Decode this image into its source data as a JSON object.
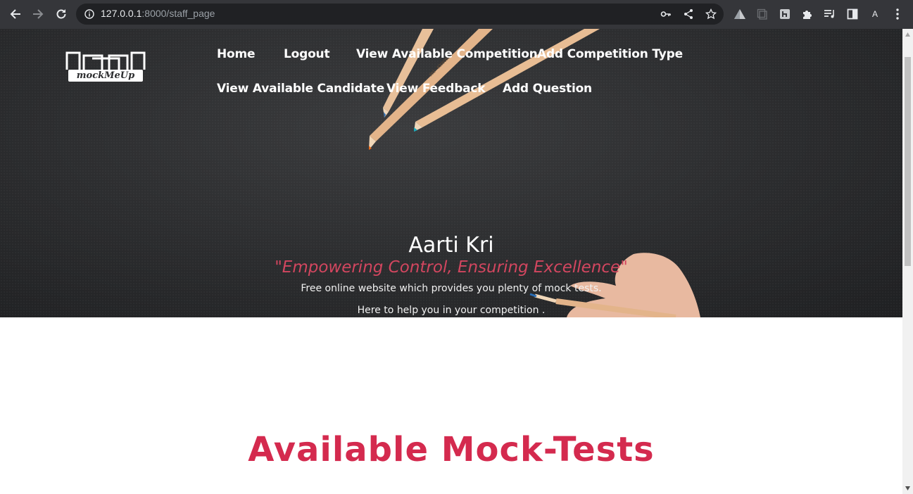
{
  "browser": {
    "url_host": "127.0.0.1",
    "url_rest": ":8000/staff_page",
    "profile_initial": "A"
  },
  "site": {
    "logo_text": "mockMeUp",
    "nav": [
      {
        "label": "Home"
      },
      {
        "label": "Logout"
      },
      {
        "label": "View Available Competition"
      },
      {
        "label": "Add Competition Type"
      },
      {
        "label": "View Available Candidate"
      },
      {
        "label": "View Feedback"
      },
      {
        "label": "Add Question"
      }
    ]
  },
  "hero": {
    "name": "Aarti Kri",
    "tagline": "\"Empowering Control, Ensuring Excellence\"",
    "desc1": "Free online website which provides you plenty of mock tests.",
    "desc2": "Here to help you in your competition ."
  },
  "main": {
    "section_title": "Available Mock-Tests"
  },
  "colors": {
    "accent": "#d42a4e",
    "tagline": "#d2465f",
    "chrome_bg": "#35363a",
    "omnibox_bg": "#202124"
  }
}
